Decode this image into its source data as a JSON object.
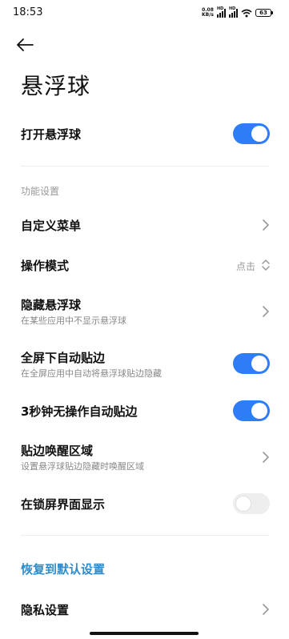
{
  "status_bar": {
    "time": "18:53",
    "net_speed_value": "0.08",
    "net_speed_unit": "KB/s",
    "signal1_label": "HD",
    "signal2_label": "HD",
    "battery_level": "63"
  },
  "header": {
    "title": "悬浮球"
  },
  "main_toggle": {
    "label": "打开悬浮球",
    "on": true
  },
  "section": {
    "label": "功能设置"
  },
  "items": [
    {
      "label": "自定义菜单"
    },
    {
      "label": "操作模式",
      "value": "点击"
    },
    {
      "label": "隐藏悬浮球",
      "sub": "在某些应用中不显示悬浮球"
    },
    {
      "label": "全屏下自动贴边",
      "sub": "在全屏应用中自动将悬浮球贴边隐藏",
      "on": true
    },
    {
      "label": "3秒钟无操作自动贴边",
      "on": true
    },
    {
      "label": "贴边唤醒区域",
      "sub": "设置悬浮球贴边隐藏时唤醒区域"
    },
    {
      "label": "在锁屏界面显示",
      "on": false
    }
  ],
  "restore": {
    "label": "恢复到默认设置"
  },
  "privacy": {
    "label": "隐私设置"
  },
  "colors": {
    "accent": "#2f7df6",
    "link": "#2f8cc8"
  }
}
